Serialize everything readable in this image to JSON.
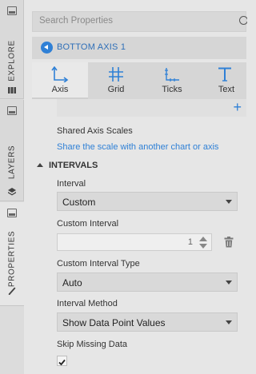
{
  "side_tabs": [
    {
      "label": "EXPLORE"
    },
    {
      "label": "LAYERS"
    },
    {
      "label": "PROPERTIES"
    }
  ],
  "search": {
    "placeholder": "Search Properties"
  },
  "nav": {
    "title": "BOTTOM AXIS 1"
  },
  "subtabs": [
    {
      "label": "Axis",
      "icon": "axis-icon",
      "active": true
    },
    {
      "label": "Grid",
      "icon": "grid-icon"
    },
    {
      "label": "Ticks",
      "icon": "ticks-icon"
    },
    {
      "label": "Text",
      "icon": "text-icon"
    }
  ],
  "shared_axis": {
    "label": "Shared Axis Scales",
    "link": "Share the scale with another chart or axis"
  },
  "intervals": {
    "section_title": "INTERVALS",
    "interval_label": "Interval",
    "interval_value": "Custom",
    "custom_interval_label": "Custom Interval",
    "custom_interval_value": "1",
    "custom_interval_type_label": "Custom Interval Type",
    "custom_interval_type_value": "Auto",
    "interval_method_label": "Interval Method",
    "interval_method_value": "Show Data Point Values",
    "skip_missing_label": "Skip Missing Data",
    "skip_missing_checked": true
  },
  "colors": {
    "accent": "#2f80d6",
    "panel": "#e6e6e6"
  }
}
